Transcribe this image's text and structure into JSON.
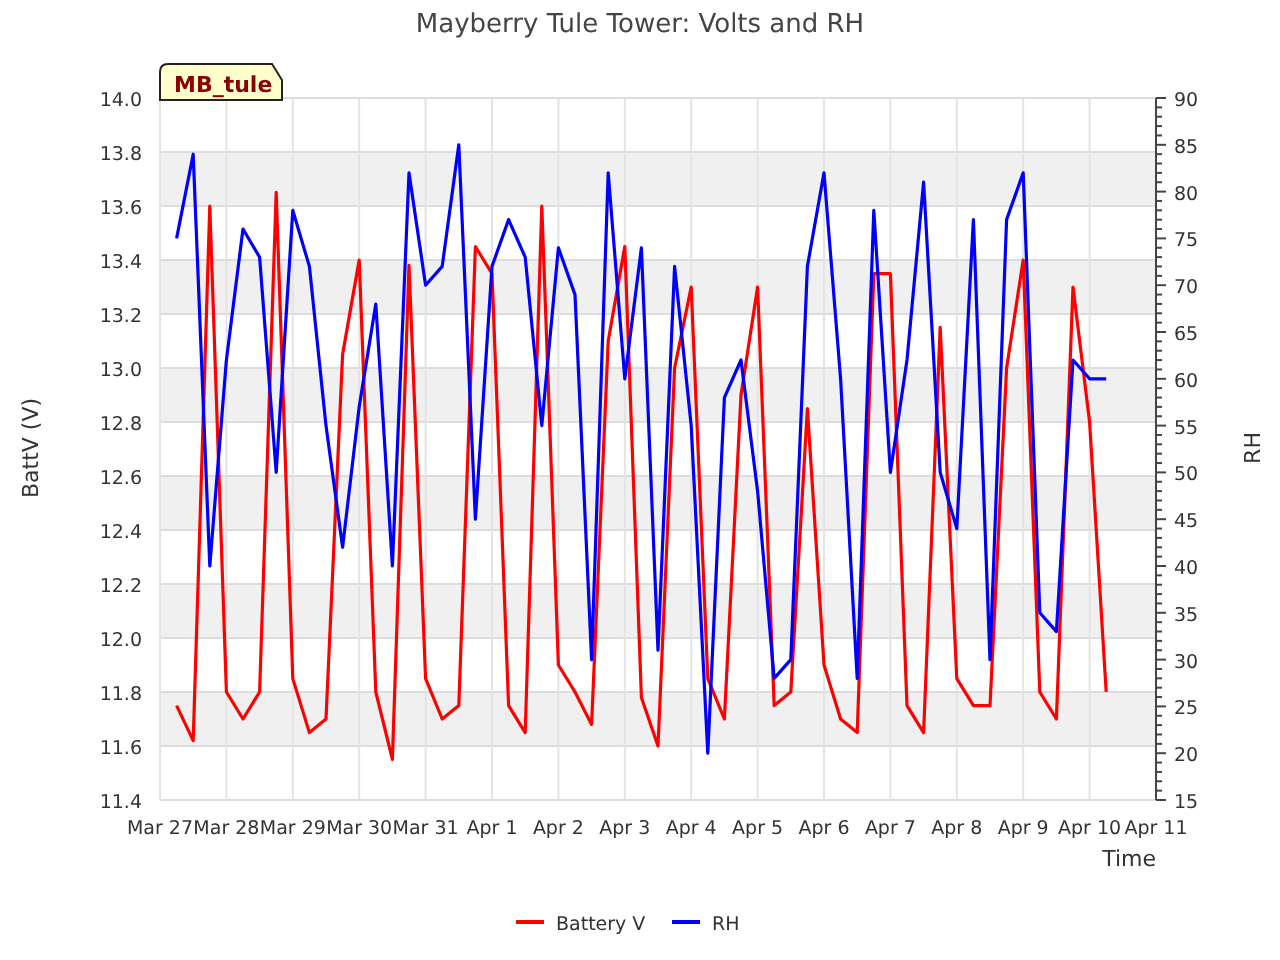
{
  "badge": "MB_tule",
  "chart_data": {
    "type": "line",
    "grid": true,
    "legend": "bottom",
    "title": "Mayberry Tule Tower: Volts and RH",
    "xlabel": "Time",
    "ylabel": "BattV (V)",
    "y2label": "RH",
    "categories": [
      "Mar 27",
      null,
      null,
      null,
      "Mar 28",
      null,
      null,
      null,
      "Mar 29",
      null,
      null,
      null,
      "Mar 30",
      null,
      null,
      null,
      "Mar 31",
      null,
      null,
      null,
      "Apr 1",
      null,
      null,
      null,
      "Apr 2",
      null,
      null,
      null,
      "Apr 3",
      null,
      null,
      null,
      "Apr 4",
      null,
      null,
      null,
      "Apr 5",
      null,
      null,
      null,
      "Apr 6",
      null,
      null,
      null,
      "Apr 7",
      null,
      null,
      null,
      "Apr 8",
      null,
      null,
      null,
      "Apr 9",
      null,
      null,
      null,
      "Apr 10",
      null,
      null,
      null,
      "Apr 11"
    ],
    "ylim": [
      11.4,
      14.0
    ],
    "yticks": [
      {
        "value": 11.4,
        "label": "11.4"
      },
      {
        "value": 11.6,
        "label": "11.6"
      },
      {
        "value": 11.8,
        "label": "11.8"
      },
      {
        "value": 12.0,
        "label": "12.0"
      },
      {
        "value": 12.2,
        "label": "12.2"
      },
      {
        "value": 12.4,
        "label": "12.4"
      },
      {
        "value": 12.6,
        "label": "12.6"
      },
      {
        "value": 12.8,
        "label": "12.8"
      },
      {
        "value": 13.0,
        "label": "13.0"
      },
      {
        "value": 13.2,
        "label": "13.2"
      },
      {
        "value": 13.4,
        "label": "13.4"
      },
      {
        "value": 13.6,
        "label": "13.6"
      },
      {
        "value": 13.8,
        "label": "13.8"
      },
      {
        "value": 14.0,
        "label": "14.0"
      }
    ],
    "y2lim": [
      15,
      90
    ],
    "y2ticks": [
      15,
      20,
      25,
      30,
      35,
      40,
      45,
      50,
      55,
      60,
      65,
      70,
      75,
      80,
      85,
      90
    ],
    "series": [
      {
        "name": "Battery V",
        "color": "#ff0000",
        "values": [
          null,
          11.75,
          11.62,
          13.6,
          11.8,
          11.7,
          11.8,
          13.65,
          11.85,
          11.65,
          11.7,
          13.05,
          13.4,
          11.8,
          11.55,
          13.38,
          11.85,
          11.7,
          11.75,
          13.45,
          13.35,
          11.75,
          11.65,
          13.6,
          11.9,
          11.8,
          11.68,
          13.1,
          13.45,
          11.78,
          11.6,
          13.0,
          13.3,
          11.85,
          11.7,
          12.9,
          13.3,
          11.75,
          11.8,
          12.85,
          11.9,
          11.7,
          11.65,
          13.35,
          13.35,
          11.75,
          11.65,
          13.15,
          11.85,
          11.75,
          11.75,
          13.0,
          13.4,
          11.8,
          11.7,
          13.3,
          12.8,
          11.8,
          null,
          null,
          null
        ]
      },
      {
        "name": "RH",
        "color": "#0000ff",
        "axis": "y2",
        "values": [
          null,
          75,
          84,
          40,
          62,
          76,
          73,
          50,
          78,
          72,
          55,
          42,
          57,
          68,
          40,
          82,
          70,
          72,
          85,
          45,
          72,
          77,
          73,
          55,
          74,
          69,
          30,
          82,
          60,
          74,
          31,
          72,
          55,
          20,
          58,
          62,
          48,
          28,
          30,
          72,
          82,
          60,
          28,
          78,
          50,
          62,
          81,
          50,
          44,
          77,
          30,
          77,
          82,
          35,
          33,
          62,
          60,
          60,
          null,
          null,
          null
        ]
      }
    ]
  }
}
